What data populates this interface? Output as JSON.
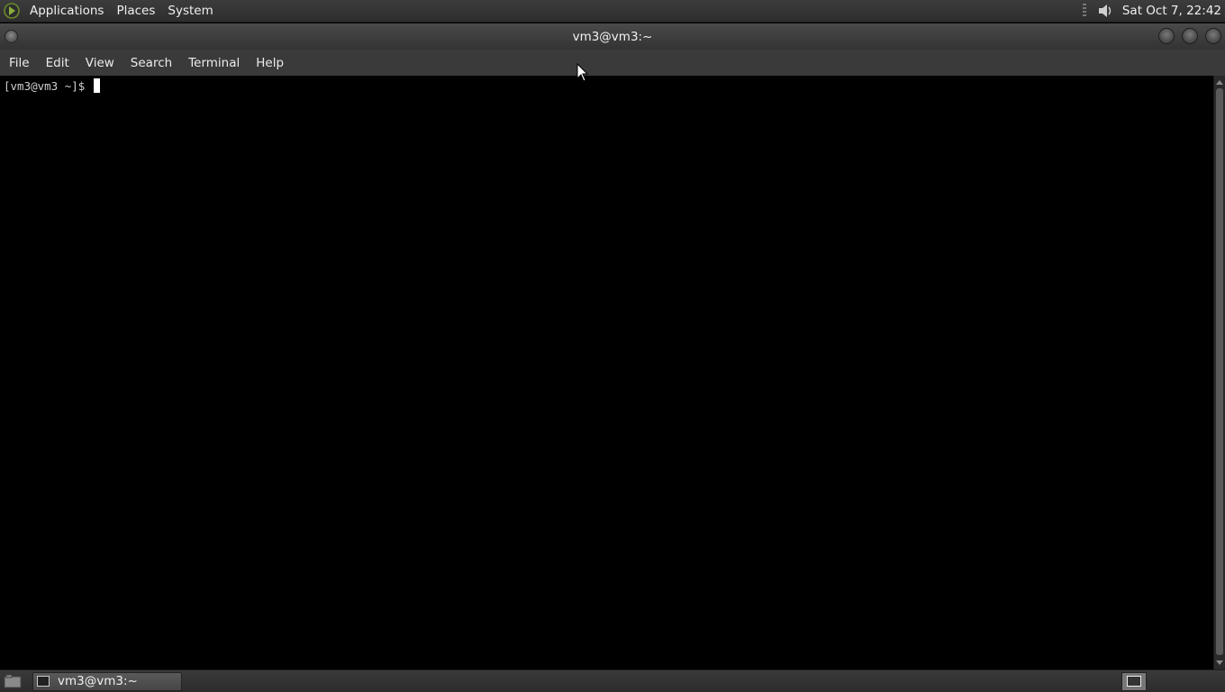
{
  "top_panel": {
    "menus": [
      "Applications",
      "Places",
      "System"
    ],
    "clock": "Sat Oct  7, 22:42",
    "icons": {
      "logo": "distro-logo-icon",
      "volume": "speaker-volume-icon"
    }
  },
  "window": {
    "title": "vm3@vm3:~",
    "menu": [
      "File",
      "Edit",
      "View",
      "Search",
      "Terminal",
      "Help"
    ]
  },
  "terminal": {
    "prompt": "[vm3@vm3 ~]$ "
  },
  "taskbar": {
    "task_label": "vm3@vm3:~"
  },
  "colors": {
    "panel_bg": "#333333",
    "terminal_bg": "#000000",
    "terminal_fg": "#d0d0d0"
  }
}
